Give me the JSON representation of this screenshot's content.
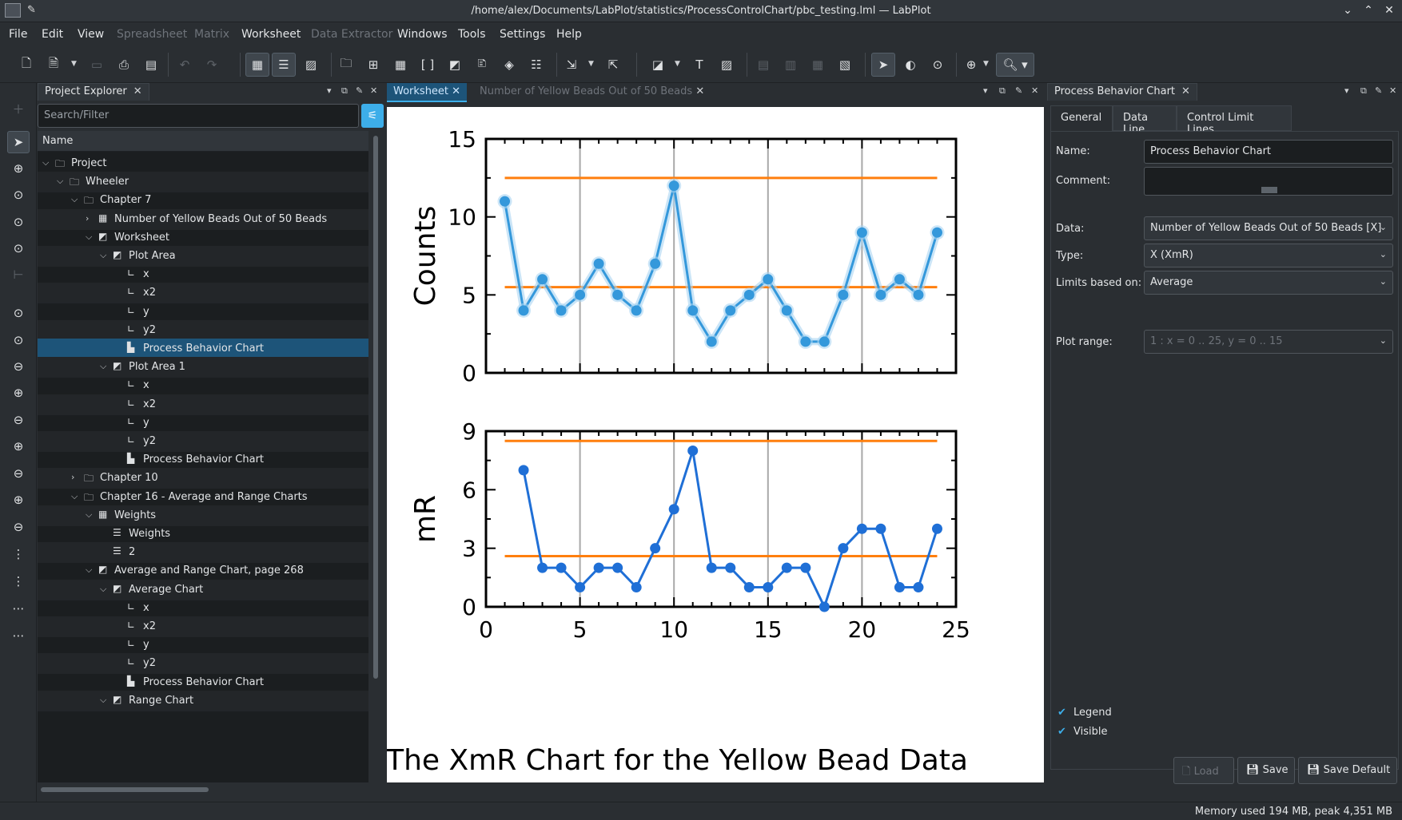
{
  "window": {
    "title": "/home/alex/Documents/LabPlot/statistics/ProcessControlChart/pbc_testing.lml — LabPlot"
  },
  "menu": [
    "File",
    "Edit",
    "View",
    "Spreadsheet",
    "Matrix",
    "Worksheet",
    "Data Extractor",
    "Windows",
    "Tools",
    "Settings",
    "Help"
  ],
  "explorer": {
    "title": "Project Explorer",
    "search_placeholder": "Search/Filter",
    "column": "Name",
    "tree": [
      {
        "label": "Project"
      },
      {
        "label": "Wheeler"
      },
      {
        "label": "Chapter 7"
      },
      {
        "label": "Number of Yellow Beads Out of 50 Beads"
      },
      {
        "label": "Worksheet"
      },
      {
        "label": "Plot Area"
      },
      {
        "label": "x"
      },
      {
        "label": "x2"
      },
      {
        "label": "y"
      },
      {
        "label": "y2"
      },
      {
        "label": "Process Behavior Chart"
      },
      {
        "label": "Plot Area 1"
      },
      {
        "label": "x"
      },
      {
        "label": "x2"
      },
      {
        "label": "y"
      },
      {
        "label": "y2"
      },
      {
        "label": "Process Behavior Chart"
      },
      {
        "label": "Chapter 10"
      },
      {
        "label": "Chapter 16 - Average and Range Charts"
      },
      {
        "label": "Weights"
      },
      {
        "label": "Weights"
      },
      {
        "label": "2"
      },
      {
        "label": "Average and Range Chart, page 268"
      },
      {
        "label": "Average Chart"
      },
      {
        "label": "x"
      },
      {
        "label": "x2"
      },
      {
        "label": "y"
      },
      {
        "label": "y2"
      },
      {
        "label": "Process Behavior Chart"
      },
      {
        "label": "Range Chart"
      }
    ]
  },
  "center": {
    "tabs": [
      "Worksheet",
      "Number of Yellow Beads Out of 50 Beads"
    ],
    "figure_title": "The XmR Chart for the Yellow Bead Data"
  },
  "chart_data": [
    {
      "type": "line",
      "ylabel": "Counts",
      "xlim": [
        0,
        25
      ],
      "ylim": [
        0,
        15
      ],
      "yticks": [
        "0",
        "5",
        "10",
        "15"
      ],
      "x": [
        1,
        2,
        3,
        4,
        5,
        6,
        7,
        8,
        9,
        10,
        11,
        12,
        13,
        14,
        15,
        16,
        17,
        18,
        19,
        20,
        21,
        22,
        23,
        24
      ],
      "values": [
        11,
        4,
        6,
        4,
        5,
        7,
        5,
        4,
        7,
        12,
        4,
        2,
        4,
        5,
        6,
        4,
        2,
        2,
        5,
        9,
        5,
        6,
        5,
        9
      ],
      "center_line": 5.5,
      "upper_limit": 12.5,
      "line_color": "#3498db",
      "limit_color": "#ff7f0e",
      "grid": "vertical"
    },
    {
      "type": "line",
      "ylabel": "mR",
      "xlim": [
        0,
        25
      ],
      "ylim": [
        0,
        9
      ],
      "yticks": [
        "0",
        "3",
        "6",
        "9"
      ],
      "xticks": [
        "0",
        "5",
        "10",
        "15",
        "20",
        "25"
      ],
      "x": [
        2,
        3,
        4,
        5,
        6,
        7,
        8,
        9,
        10,
        11,
        12,
        13,
        14,
        15,
        16,
        17,
        18,
        19,
        20,
        21,
        22,
        23,
        24
      ],
      "values": [
        7,
        2,
        2,
        1,
        2,
        2,
        1,
        3,
        5,
        8,
        2,
        2,
        1,
        1,
        2,
        2,
        0,
        3,
        4,
        4,
        1,
        1,
        4
      ],
      "center_line": 2.6,
      "upper_limit": 8.5,
      "line_color": "#1f6fd6",
      "limit_color": "#ff7f0e",
      "grid": "vertical"
    }
  ],
  "props": {
    "title": "Process Behavior Chart",
    "tabs": [
      "General",
      "Data Line",
      "Control Limit Lines"
    ],
    "name_label": "Name:",
    "name_value": "Process Behavior Chart",
    "comment_label": "Comment:",
    "data_label": "Data:",
    "data_value": "Number of Yellow Beads Out of 50 Beads [X]",
    "type_label": "Type:",
    "type_value": "X (XmR)",
    "limits_label": "Limits based on:",
    "limits_value": "Average",
    "range_label": "Plot range:",
    "range_value": "1 : x = 0 .. 25, y = 0 .. 15",
    "legend_label": "Legend",
    "visible_label": "Visible",
    "btn_load": "Load",
    "btn_save": "Save",
    "btn_save_default": "Save Default"
  },
  "status": {
    "memory": "Memory used 194 MB, peak 4,351 MB"
  }
}
